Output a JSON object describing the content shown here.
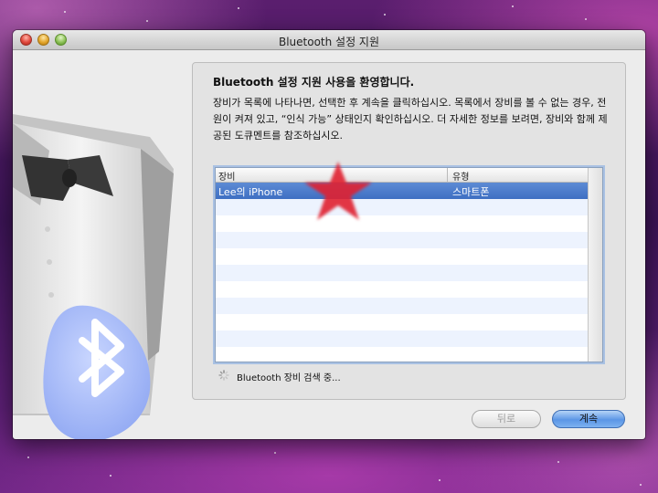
{
  "window": {
    "title": "Bluetooth 설정 지원"
  },
  "panel": {
    "welcome": "Bluetooth 설정 지원 사용을 환영합니다.",
    "instructions": "장비가 목록에 나타나면, 선택한 후 계속을 클릭하십시오. 목록에서 장비를 볼 수 없는 경우, 전원이 켜져 있고, “인식 가능” 상태인지 확인하십시오. 더 자세한 정보를 보려면, 장비와 함께 제공된 도큐멘트를 참조하십시오."
  },
  "table": {
    "columns": [
      "장비",
      "유형"
    ],
    "rows": [
      {
        "device": "Lee의 iPhone",
        "type": "스마트폰",
        "selected": true
      }
    ]
  },
  "status": {
    "text": "Bluetooth 장비 검색 중..."
  },
  "buttons": {
    "back": "뒤로",
    "continue": "계속"
  },
  "annotation": {
    "color": "#e02030",
    "icon": "star-icon"
  }
}
